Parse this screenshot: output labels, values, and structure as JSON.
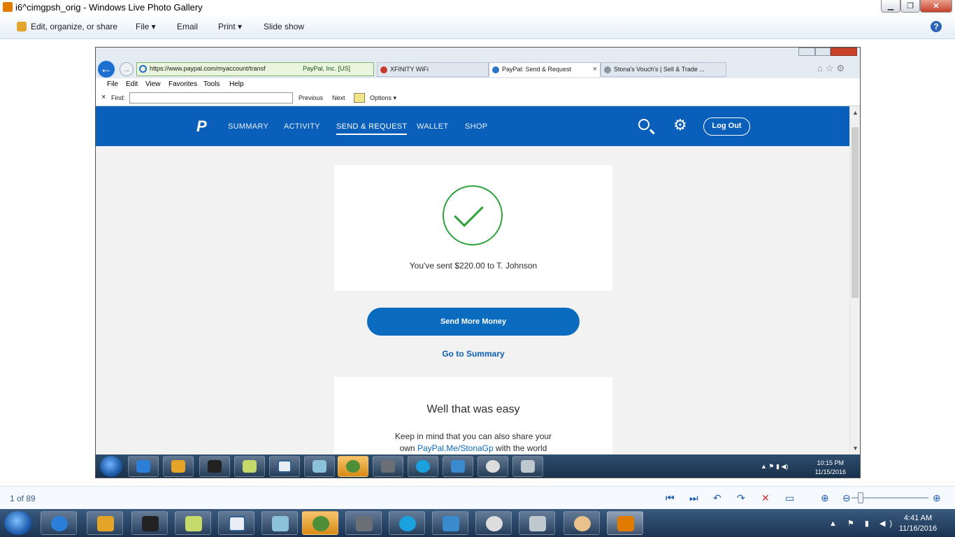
{
  "window": {
    "title": "i6^cimgpsh_orig - Windows Live Photo Gallery",
    "buttons": {
      "minimize": "▁",
      "maximize": "❐",
      "close": "✕"
    }
  },
  "toolbar": {
    "items": [
      "Edit, organize, or share",
      "File ▾",
      "Email",
      "Print ▾",
      "Slide show"
    ],
    "help": "?"
  },
  "ie": {
    "address_url": "https://www.paypal.com/myaccount/transf",
    "cert": "PayPal, Inc. [US]",
    "tabs": [
      {
        "label": "XFINITY WiFi",
        "active": false
      },
      {
        "label": "PayPal: Send & Request",
        "active": true
      },
      {
        "label": "Stona's Vouch's | Sell & Trade ...",
        "active": false
      }
    ],
    "menu": [
      "File",
      "Edit",
      "View",
      "Favorites",
      "Tools",
      "Help"
    ],
    "find": {
      "close": "×",
      "label": "Find:",
      "value": "",
      "previous": "Previous",
      "next": "Next",
      "options": "Options ▾"
    }
  },
  "paypal": {
    "nav": [
      "SUMMARY",
      "ACTIVITY",
      "SEND & REQUEST",
      "WALLET",
      "SHOP"
    ],
    "active_nav": "SEND & REQUEST",
    "logout": "Log Out",
    "sent_message": "You've sent $220.00 to T. Johnson",
    "send_more": "Send More Money",
    "go_summary": "Go to Summary",
    "easy_title": "Well that was easy",
    "keep_text_1": "Keep in mind that you can also share your",
    "keep_text_2a": "own ",
    "keep_link": "PayPal.Me/StonaGp",
    "keep_text_2b": " with the world",
    "brand_color": "#0a5fba"
  },
  "inner_taskbar": {
    "time": "10:15 PM",
    "date": "11/15/2016"
  },
  "status": {
    "counter": "1 of 89"
  },
  "taskbar": {
    "time": "4:41 AM",
    "date": "11/16/2016"
  },
  "icons": [
    "windows-start-icon",
    "ie-icon",
    "checkmark-icon",
    "search-icon",
    "gear-icon",
    "help-icon"
  ]
}
